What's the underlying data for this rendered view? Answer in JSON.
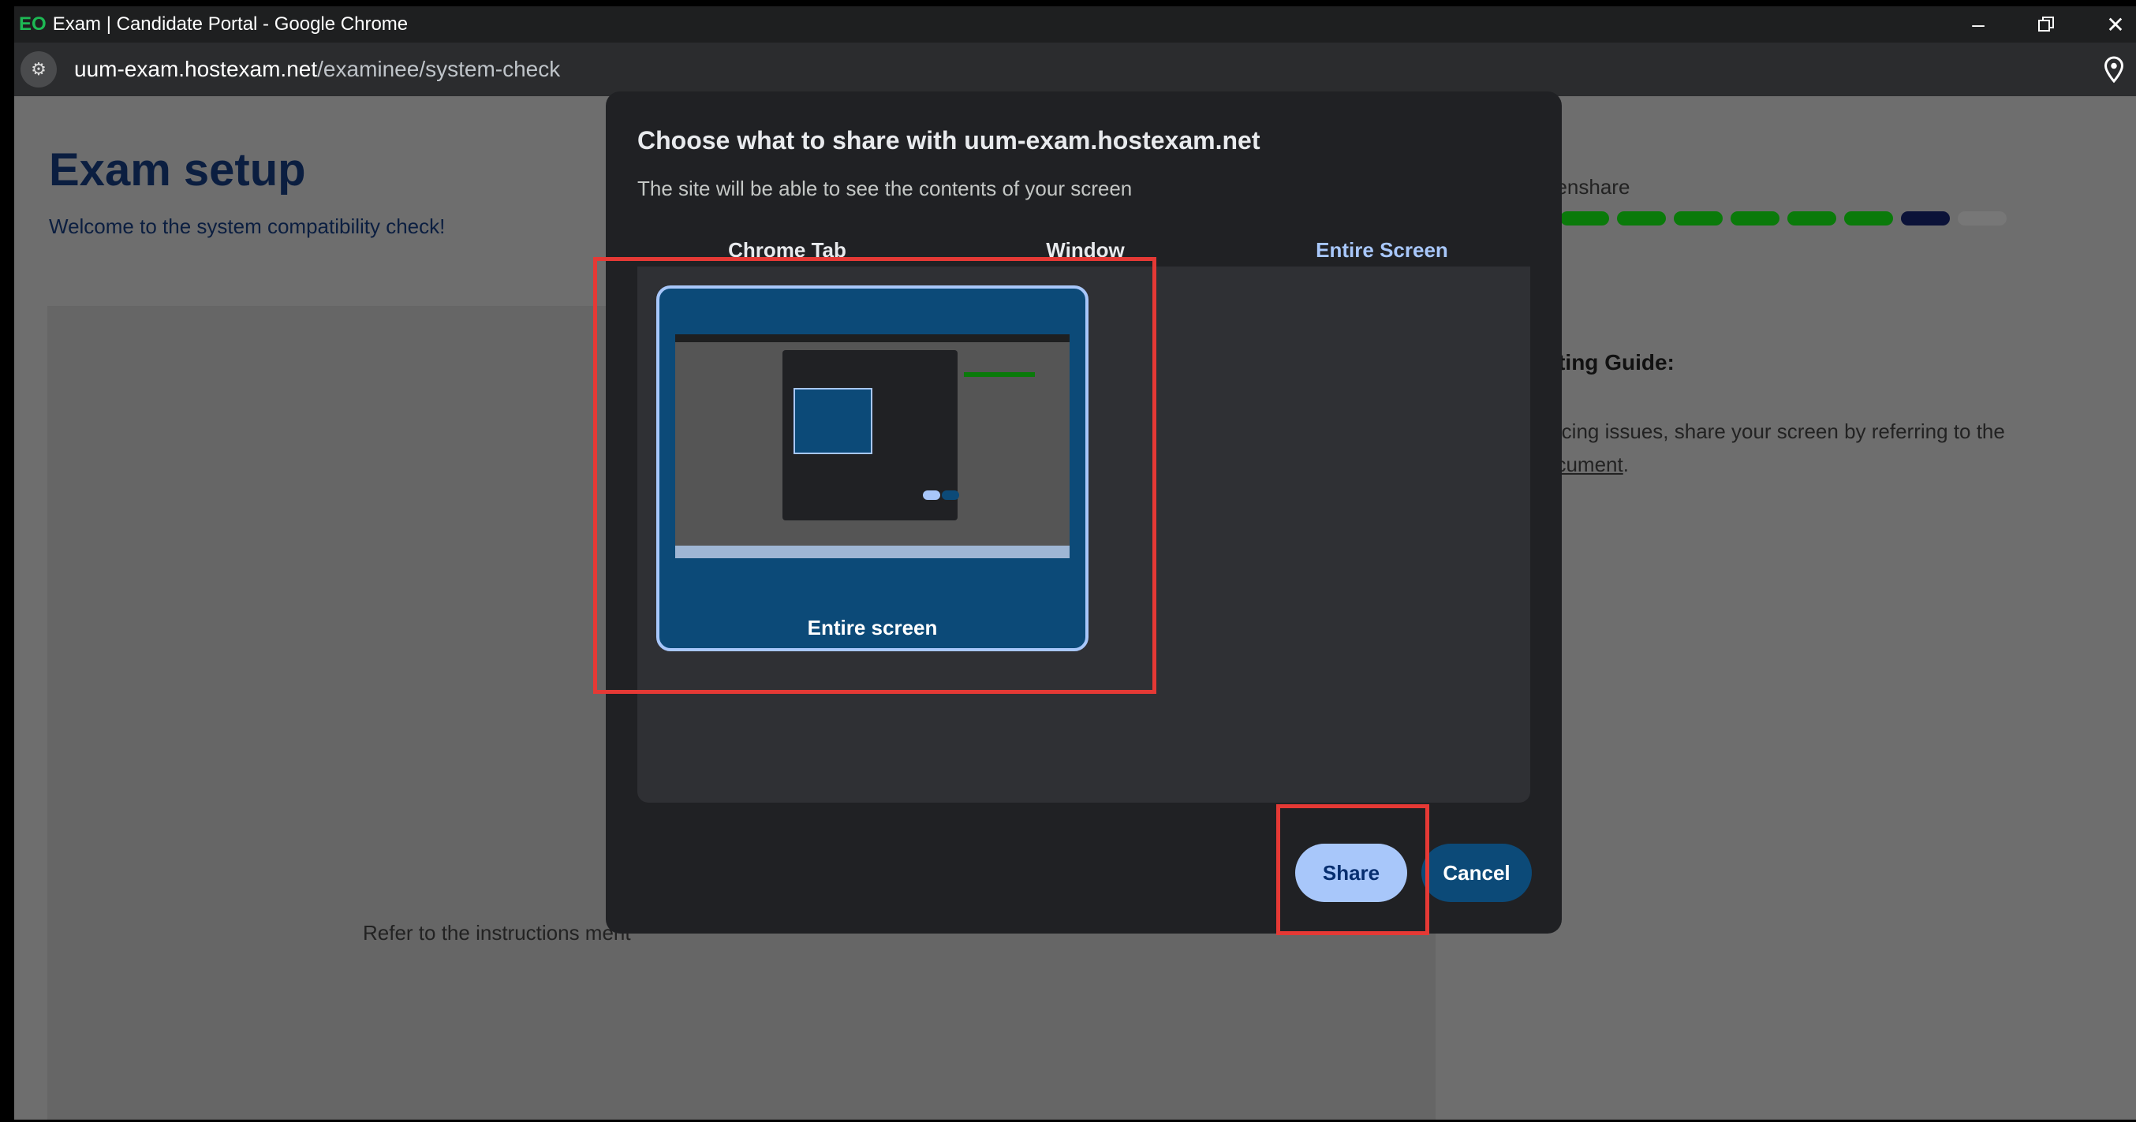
{
  "browser": {
    "title": "Exam | Candidate Portal - Google Chrome",
    "logo": "EO",
    "url_host": "uum-exam.hostexam.net",
    "url_path": "/examinee/system-check",
    "controls": [
      "minimize-icon",
      "restore-icon",
      "close-icon"
    ]
  },
  "page": {
    "heading": "Exam setup",
    "welcome": "Welcome to the system compatibility check!",
    "refer_text": "Refer to the instructions ment",
    "screenshare_label": "eenshare",
    "progress": {
      "completed": 6,
      "current": 1,
      "remaining": 1
    },
    "guide_title": "oting Guide:",
    "guide_text": "facing issues, share your screen by referring to the",
    "guide_link": "ocument",
    "guide_period": "."
  },
  "dialog": {
    "title": "Choose what to share with uum-exam.hostexam.net",
    "subtitle": "The site will be able to see the contents of your screen",
    "tabs": [
      {
        "label": "Chrome Tab",
        "active": false
      },
      {
        "label": "Window",
        "active": false
      },
      {
        "label": "Entire Screen",
        "active": true
      }
    ],
    "option_label": "Entire screen",
    "share_label": "Share",
    "cancel_label": "Cancel"
  },
  "colors": {
    "accent": "#a8c7fa",
    "highlight": "#e53935",
    "progress_done": "#0a7a0a",
    "progress_current": "#0b1238"
  }
}
